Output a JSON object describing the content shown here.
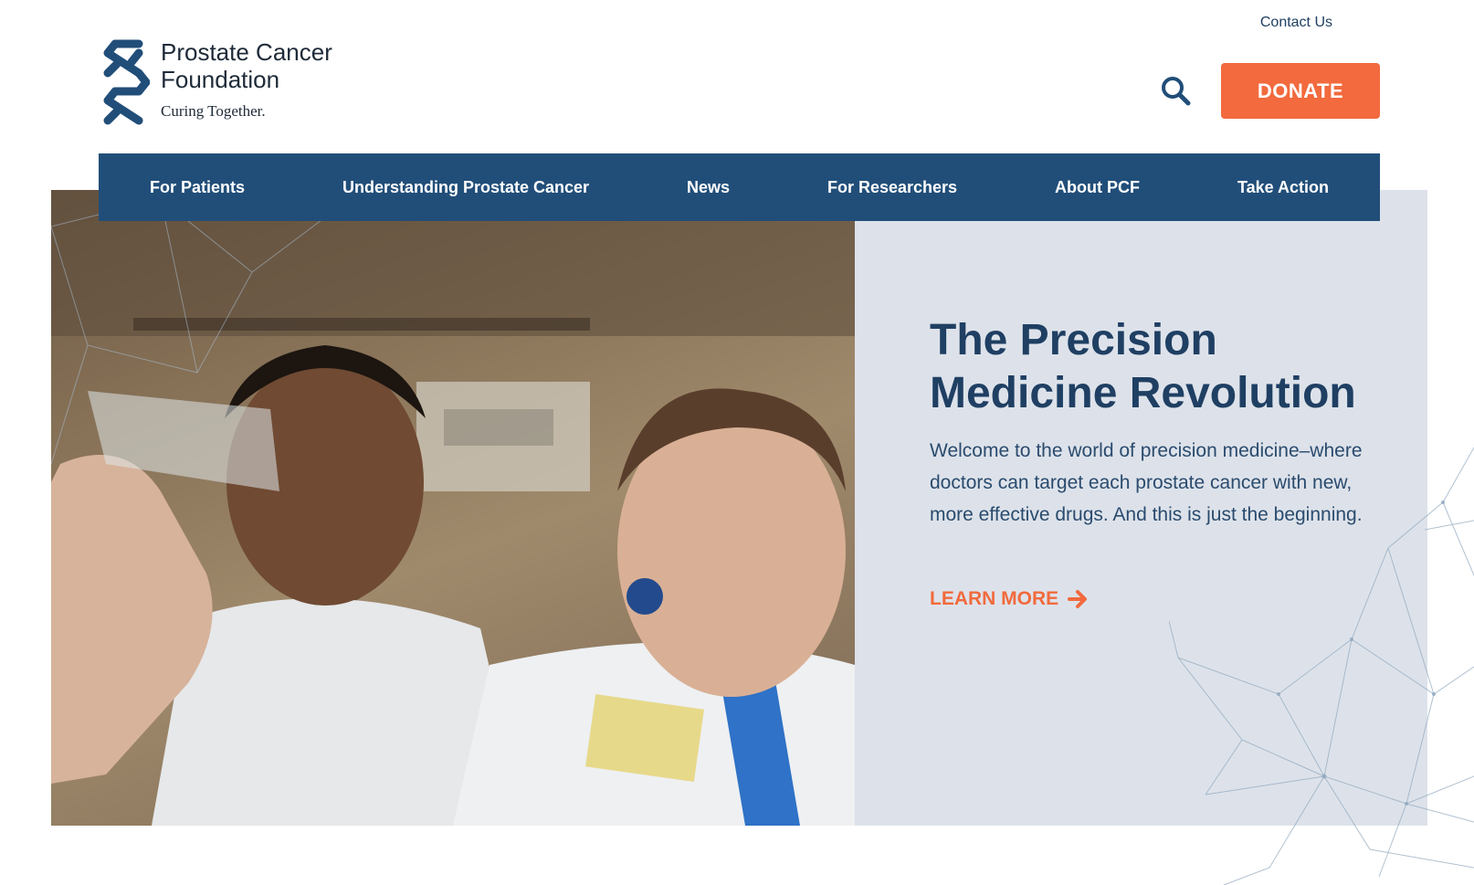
{
  "header": {
    "contact_label": "Contact Us",
    "logo": {
      "name_line1": "Prostate Cancer",
      "name_line2": "Foundation",
      "tagline": "Curing Together."
    },
    "search_icon": "search-icon",
    "donate_label": "DONATE"
  },
  "nav": {
    "items": [
      {
        "label": "For Patients"
      },
      {
        "label": "Understanding Prostate Cancer"
      },
      {
        "label": "News"
      },
      {
        "label": "For Researchers"
      },
      {
        "label": "About PCF"
      },
      {
        "label": "Take Action"
      }
    ]
  },
  "hero": {
    "title_line1": "The Precision",
    "title_line2": "Medicine Revolution",
    "text": "Welcome to the world of precision medicine–where doctors can target each prostate cancer with new, more effective drugs. And this is just the beginning.",
    "cta_label": "LEARN MORE",
    "cta_icon": "arrow-right-icon"
  },
  "colors": {
    "brand_navy": "#214e79",
    "accent_orange": "#f26a3d",
    "hero_panel": "#dde2ea",
    "heading": "#1f3f63"
  }
}
